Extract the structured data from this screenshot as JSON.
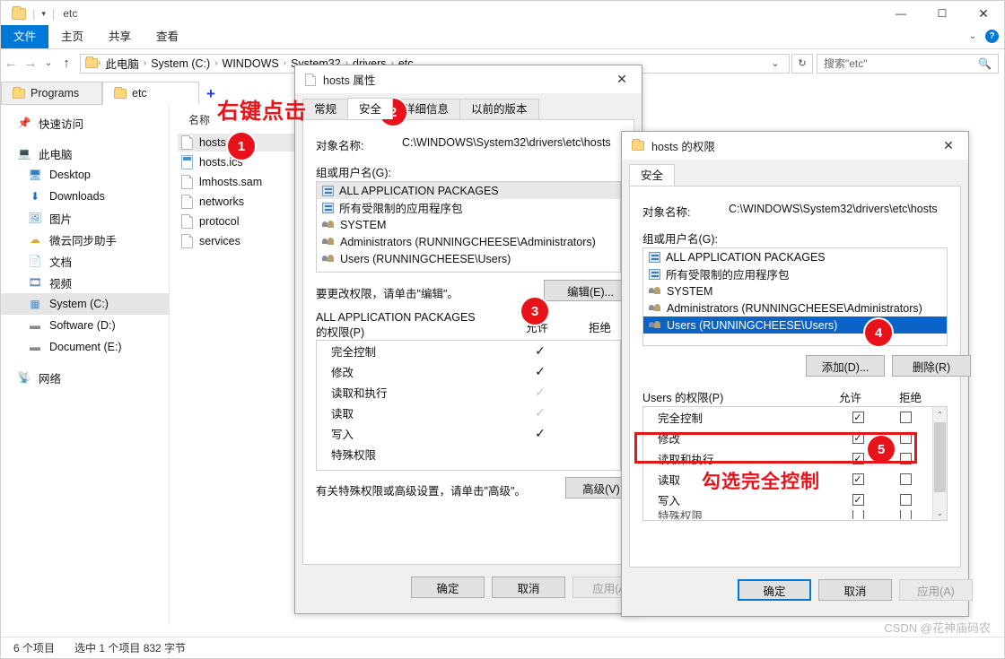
{
  "explorer": {
    "title": "etc",
    "quick_access_caret": "▾",
    "window_buttons": {
      "minimize": "—",
      "maximize": "☐",
      "close": "✕"
    },
    "ribbon_tabs": [
      {
        "label": "文件",
        "active": true
      },
      {
        "label": "主页",
        "active": false
      },
      {
        "label": "共享",
        "active": false
      },
      {
        "label": "查看",
        "active": false
      }
    ],
    "ribbon_right": {
      "collapse": "⌄",
      "help": "?"
    },
    "nav": {
      "back": "←",
      "forward": "→",
      "recent": "⌄",
      "up": "↑"
    },
    "breadcrumb": [
      "此电脑",
      "System (C:)",
      "WINDOWS",
      "System32",
      "drivers",
      "etc"
    ],
    "breadcrumb_sep": "›",
    "address_tools": {
      "history_caret": "⌄",
      "refresh": "↻"
    },
    "search": {
      "placeholder": "搜索\"etc\"",
      "icon": "🔎"
    },
    "folder_tabs": [
      {
        "label": "Programs",
        "selected": false
      },
      {
        "label": "etc",
        "selected": true
      }
    ],
    "sidebar": [
      {
        "label": "快速访问",
        "icon": "pin-icon",
        "glyph": "📌",
        "indent": false,
        "selected": false
      },
      {
        "label": "此电脑",
        "icon": "this-pc-icon",
        "glyph": "🖥",
        "indent": false,
        "selected": false
      },
      {
        "label": "Desktop",
        "icon": "desktop-icon",
        "glyph": "🖵",
        "indent": true,
        "selected": false
      },
      {
        "label": "Downloads",
        "icon": "download-icon",
        "glyph": "⬇",
        "indent": true,
        "selected": false
      },
      {
        "label": "图片",
        "icon": "pictures-icon",
        "glyph": "🖼",
        "indent": true,
        "selected": false
      },
      {
        "label": "微云同步助手",
        "icon": "cloud-icon",
        "glyph": "☁",
        "indent": true,
        "selected": false
      },
      {
        "label": "文档",
        "icon": "documents-icon",
        "glyph": "📄",
        "indent": true,
        "selected": false
      },
      {
        "label": "视频",
        "icon": "videos-icon",
        "glyph": "🎞",
        "indent": true,
        "selected": false
      },
      {
        "label": "System (C:)",
        "icon": "windows-drive-icon",
        "glyph": "▤",
        "indent": true,
        "selected": true
      },
      {
        "label": "Software (D:)",
        "icon": "drive-icon",
        "glyph": "▬",
        "indent": true,
        "selected": false
      },
      {
        "label": "Document (E:)",
        "icon": "drive-icon",
        "glyph": "▬",
        "indent": true,
        "selected": false
      },
      {
        "label": "网络",
        "icon": "network-icon",
        "glyph": "🖧",
        "indent": false,
        "selected": false
      }
    ],
    "column_header": "名称",
    "files": [
      {
        "name": "hosts",
        "type": "file",
        "selected": true
      },
      {
        "name": "hosts.ics",
        "type": "ics",
        "selected": false
      },
      {
        "name": "lmhosts.sam",
        "type": "file",
        "selected": false
      },
      {
        "name": "networks",
        "type": "file",
        "selected": false
      },
      {
        "name": "protocol",
        "type": "file",
        "selected": false
      },
      {
        "name": "services",
        "type": "file",
        "selected": false
      }
    ],
    "status": {
      "items": "6 个项目",
      "selection": "选中 1 个项目  832 字节"
    }
  },
  "properties_dialog": {
    "title": "hosts 属性",
    "close": "✕",
    "tabs": [
      {
        "label": "常规",
        "active": false
      },
      {
        "label": "安全",
        "active": true
      },
      {
        "label": "详细信息",
        "active": false
      },
      {
        "label": "以前的版本",
        "active": false
      }
    ],
    "object_name_label": "对象名称:",
    "object_name_value": "C:\\WINDOWS\\System32\\drivers\\etc\\hosts",
    "group_label": "组或用户名(G):",
    "groups": [
      {
        "name": "ALL APPLICATION PACKAGES",
        "icon": "package-icon",
        "highlight": true
      },
      {
        "name": "所有受限制的应用程序包",
        "icon": "package-icon",
        "highlight": false
      },
      {
        "name": "SYSTEM",
        "icon": "users-icon",
        "highlight": false
      },
      {
        "name": "Administrators (RUNNINGCHEESE\\Administrators)",
        "icon": "users-icon",
        "highlight": false
      },
      {
        "name": "Users (RUNNINGCHEESE\\Users)",
        "icon": "users-icon",
        "highlight": false
      }
    ],
    "edit_hint": "要更改权限，请单击\"编辑\"。",
    "edit_button": "编辑(E)...",
    "perm_for_line1": "ALL APPLICATION PACKAGES",
    "perm_for_line2": "的权限(P)",
    "col_allow": "允许",
    "col_deny": "拒绝",
    "permissions": [
      {
        "name": "完全控制",
        "allow": "check",
        "deny": "none"
      },
      {
        "name": "修改",
        "allow": "check",
        "deny": "none"
      },
      {
        "name": "读取和执行",
        "allow": "check-dim",
        "deny": "none"
      },
      {
        "name": "读取",
        "allow": "check-dim",
        "deny": "none"
      },
      {
        "name": "写入",
        "allow": "check",
        "deny": "none"
      },
      {
        "name": "特殊权限",
        "allow": "none",
        "deny": "none"
      }
    ],
    "advanced_hint": "有关特殊权限或高级设置，请单击\"高级\"。",
    "advanced_button": "高级(V)",
    "footer": {
      "ok": "确定",
      "cancel": "取消",
      "apply": "应用(A"
    }
  },
  "permissions_dialog": {
    "title": "hosts 的权限",
    "close": "✕",
    "tabs": [
      {
        "label": "安全",
        "active": true
      }
    ],
    "object_name_label": "对象名称:",
    "object_name_value": "C:\\WINDOWS\\System32\\drivers\\etc\\hosts",
    "group_label": "组或用户名(G):",
    "groups": [
      {
        "name": "ALL APPLICATION PACKAGES",
        "icon": "package-icon",
        "selected": false
      },
      {
        "name": "所有受限制的应用程序包",
        "icon": "package-icon",
        "selected": false
      },
      {
        "name": "SYSTEM",
        "icon": "users-icon",
        "selected": false
      },
      {
        "name": "Administrators (RUNNINGCHEESE\\Administrators)",
        "icon": "users-icon",
        "selected": false
      },
      {
        "name": "Users (RUNNINGCHEESE\\Users)",
        "icon": "users-icon",
        "selected": true
      }
    ],
    "add_button": "添加(D)...",
    "remove_button": "删除(R)",
    "perm_for": "Users 的权限(P)",
    "col_allow": "允许",
    "col_deny": "拒绝",
    "permissions": [
      {
        "name": "完全控制",
        "allow": true,
        "deny": false
      },
      {
        "name": "修改",
        "allow": true,
        "deny": false
      },
      {
        "name": "读取和执行",
        "allow": true,
        "deny": false
      },
      {
        "name": "读取",
        "allow": true,
        "deny": false
      },
      {
        "name": "写入",
        "allow": true,
        "deny": false
      },
      {
        "name": "特殊权限",
        "allow": false,
        "deny": false
      }
    ],
    "scroll": {
      "up": "⌃",
      "down": "⌄"
    },
    "footer": {
      "ok": "确定",
      "cancel": "取消",
      "apply": "应用(A)"
    }
  },
  "annotations": {
    "badge1": "1",
    "badge2": "2",
    "badge3": "3",
    "badge4": "4",
    "badge5": "5",
    "text_right_click": "右键点击",
    "text_check_full_control": "勾选完全控制",
    "plus_mark": "+"
  },
  "watermark": "CSDN @花神庙码农",
  "colors": {
    "accent": "#0078d7",
    "annotation_red": "#e8131a",
    "selection_blue": "#0a64c8"
  }
}
